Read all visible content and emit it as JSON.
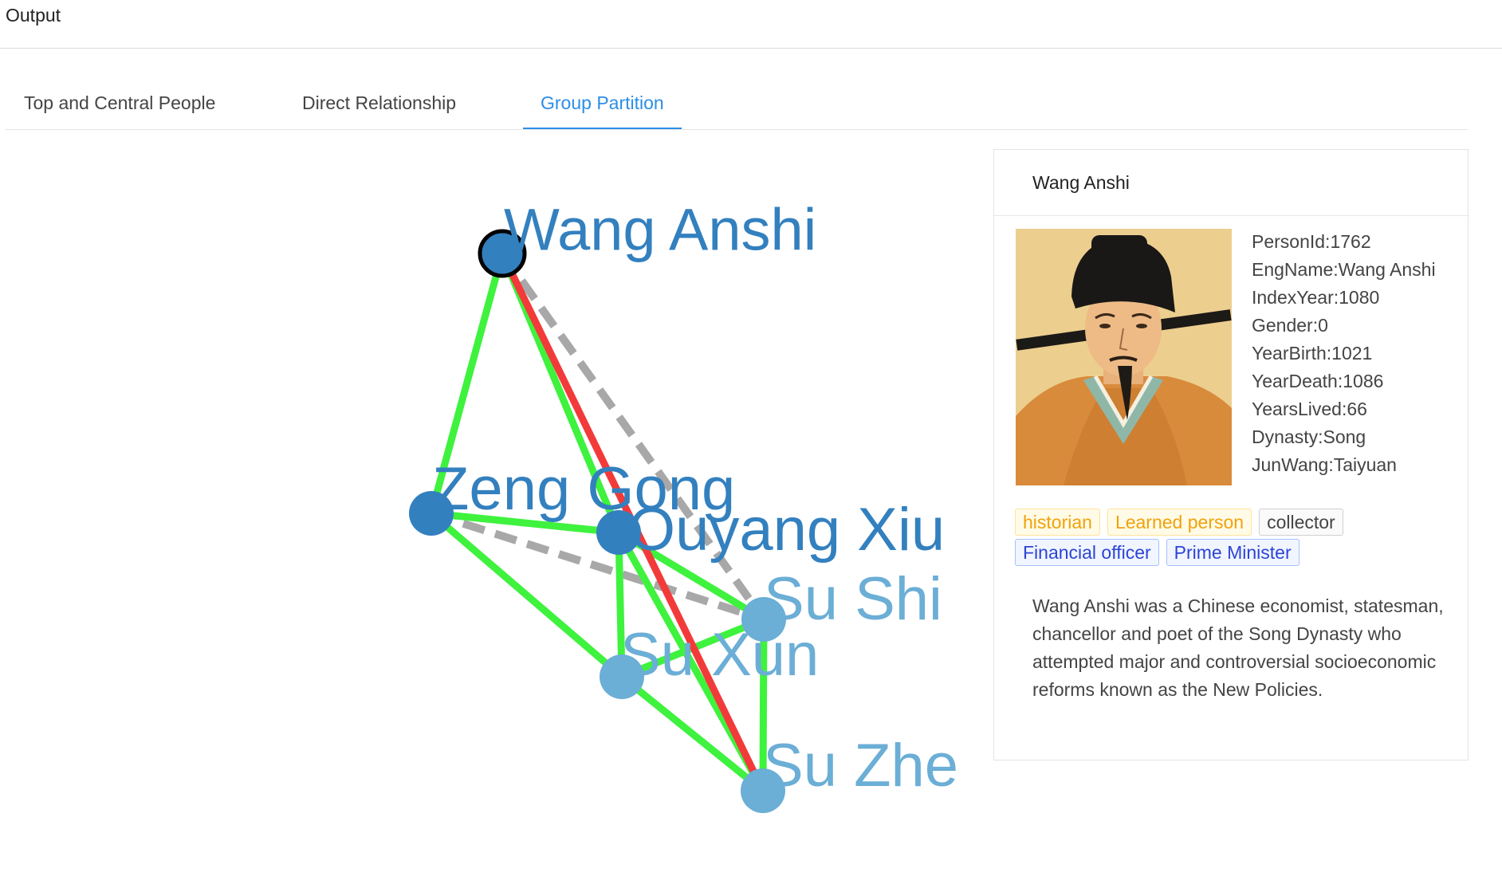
{
  "header": {
    "title": "Output"
  },
  "tabs": [
    {
      "label": "Top and Central People",
      "active": false
    },
    {
      "label": "Direct Relationship",
      "active": false
    },
    {
      "label": "Group Partition",
      "active": true
    }
  ],
  "graph": {
    "nodes": [
      {
        "id": "wang_anshi",
        "label": "Wang Anshi",
        "group": "dark",
        "selected": true
      },
      {
        "id": "zeng_gong",
        "label": "Zeng Gong",
        "group": "dark"
      },
      {
        "id": "ouyang_xiu",
        "label": "Ouyang Xiu",
        "group": "dark"
      },
      {
        "id": "su_shi",
        "label": "Su Shi",
        "group": "light"
      },
      {
        "id": "su_xun",
        "label": "Su Xun",
        "group": "light"
      },
      {
        "id": "su_zhe",
        "label": "Su Zhe",
        "group": "light"
      }
    ],
    "edges": [
      {
        "source": "wang_anshi",
        "target": "zeng_gong",
        "type": "green"
      },
      {
        "source": "wang_anshi",
        "target": "ouyang_xiu",
        "type": "green"
      },
      {
        "source": "wang_anshi",
        "target": "su_zhe",
        "type": "red"
      },
      {
        "source": "wang_anshi",
        "target": "su_shi",
        "type": "gray-dashed"
      },
      {
        "source": "zeng_gong",
        "target": "ouyang_xiu",
        "type": "green"
      },
      {
        "source": "zeng_gong",
        "target": "su_xun",
        "type": "green"
      },
      {
        "source": "zeng_gong",
        "target": "su_shi",
        "type": "gray-dashed"
      },
      {
        "source": "ouyang_xiu",
        "target": "su_shi",
        "type": "green"
      },
      {
        "source": "ouyang_xiu",
        "target": "su_xun",
        "type": "green"
      },
      {
        "source": "ouyang_xiu",
        "target": "su_zhe",
        "type": "green"
      },
      {
        "source": "su_xun",
        "target": "su_shi",
        "type": "green"
      },
      {
        "source": "su_xun",
        "target": "su_zhe",
        "type": "green"
      },
      {
        "source": "su_shi",
        "target": "su_zhe",
        "type": "green"
      }
    ],
    "colors": {
      "dark_node": "#3380bf",
      "light_node": "#6baed6",
      "green_edge": "#3ef23e",
      "red_edge": "#f33a3a",
      "gray_edge": "#a8a8a8",
      "selected_stroke": "#000000"
    }
  },
  "person": {
    "name": "Wang Anshi",
    "portrait_icon": "portrait-image",
    "attributes": [
      "PersonId:1762",
      "EngName:Wang Anshi",
      "IndexYear:1080",
      "Gender:0",
      "YearBirth:1021",
      "YearDeath:1086",
      "YearsLived:66",
      "Dynasty:Song",
      "JunWang:Taiyuan"
    ],
    "tags": [
      {
        "label": "historian",
        "color": "gold"
      },
      {
        "label": "Learned person",
        "color": "gold"
      },
      {
        "label": "collector",
        "color": "gray"
      },
      {
        "label": "Financial officer",
        "color": "blue"
      },
      {
        "label": "Prime Minister",
        "color": "blue"
      }
    ],
    "description": "Wang Anshi was a Chinese economist, statesman, chancellor and poet of the Song Dynasty who attempted major and controversial socioeconomic reforms known as the New Policies."
  }
}
